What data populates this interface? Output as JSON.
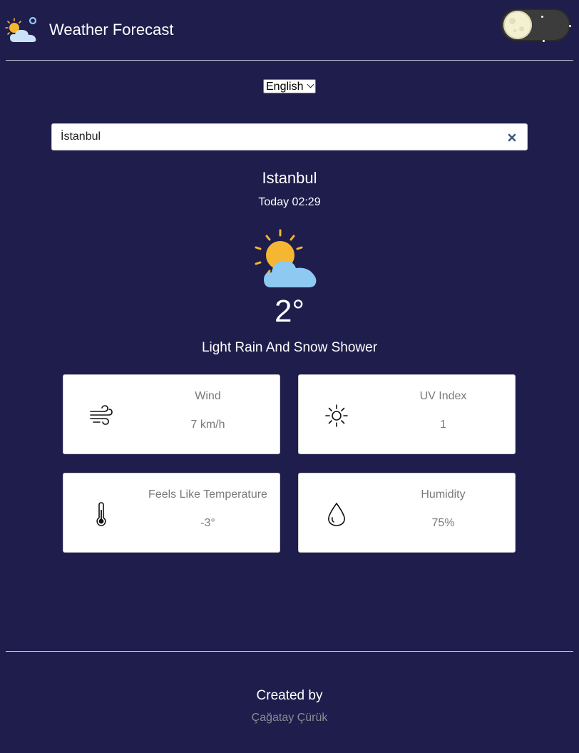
{
  "header": {
    "app_title": "Weather Forecast"
  },
  "language": {
    "selected": "English"
  },
  "search": {
    "value": "İstanbul"
  },
  "current": {
    "city": "Istanbul",
    "date_time": "Today 02:29",
    "temperature": "2°",
    "condition": "Light Rain And Snow Shower",
    "icon": "partly-cloudy-icon"
  },
  "cards": [
    {
      "label": "Wind",
      "value": "7 km/h",
      "icon": "wind-icon"
    },
    {
      "label": "UV Index",
      "value": "1",
      "icon": "sun-icon"
    },
    {
      "label": "Feels Like Temperature",
      "value": "-3°",
      "icon": "thermometer-icon"
    },
    {
      "label": "Humidity",
      "value": "75%",
      "icon": "droplet-icon"
    }
  ],
  "footer": {
    "title": "Created by",
    "author": "Çağatay Çürük"
  },
  "colors": {
    "background": "#1f1d4c",
    "card_background": "#ffffff",
    "muted_text": "#7a7a7a",
    "sun": "#f5b731",
    "cloud": "#8ec9f2"
  }
}
